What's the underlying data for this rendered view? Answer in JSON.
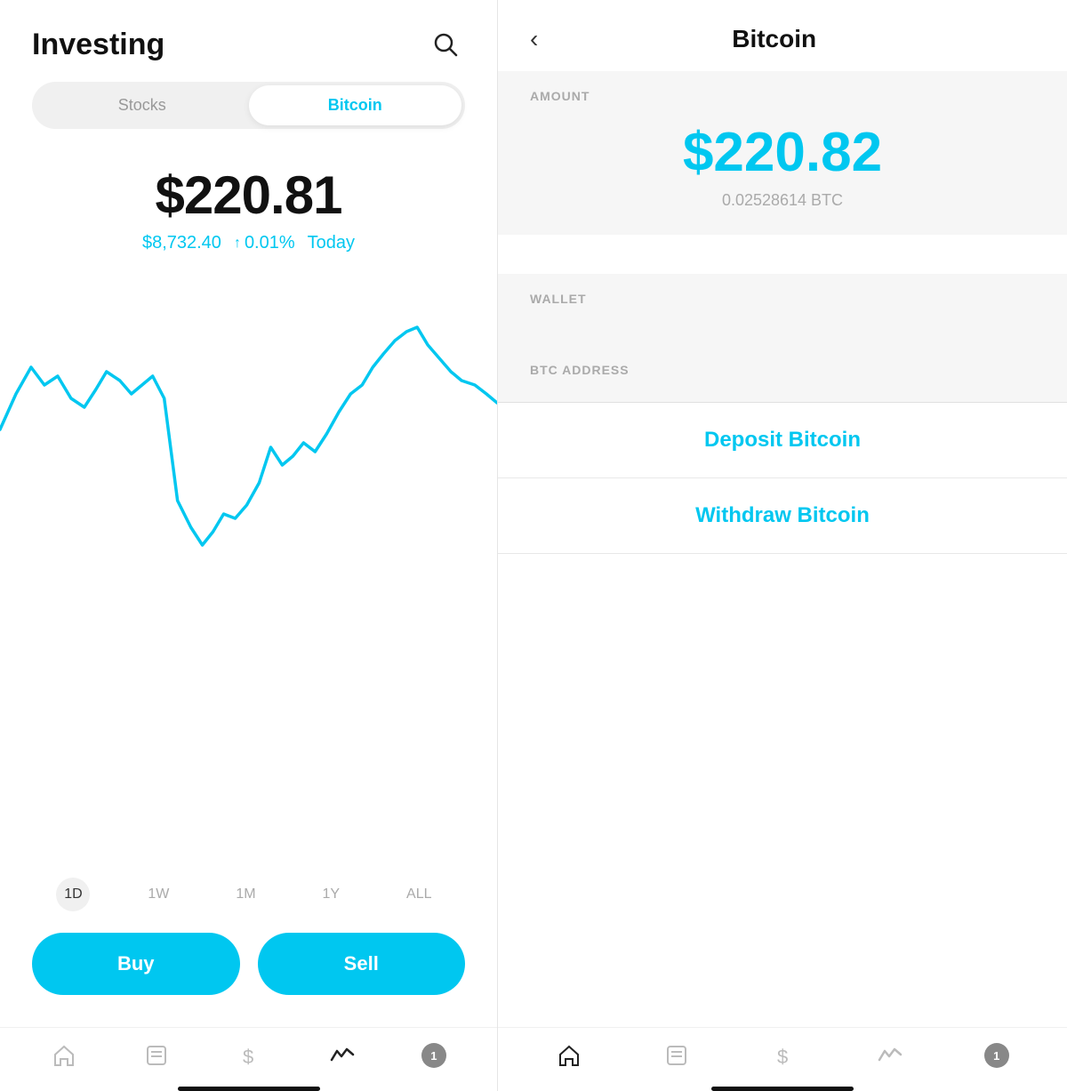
{
  "left": {
    "title": "Investing",
    "tabs": [
      {
        "label": "Stocks",
        "active": false
      },
      {
        "label": "Bitcoin",
        "active": true
      }
    ],
    "price": "$220.81",
    "btc_price": "$8,732.40",
    "change_arrow": "↑",
    "change_pct": "0.01%",
    "period": "Today",
    "time_ranges": [
      "1D",
      "1W",
      "1M",
      "1Y",
      "ALL"
    ],
    "active_range": "1D",
    "buy_label": "Buy",
    "sell_label": "Sell",
    "nav": {
      "items": [
        {
          "icon": "home-icon",
          "label": ""
        },
        {
          "icon": "news-icon",
          "label": ""
        },
        {
          "icon": "dollar-icon",
          "label": ""
        },
        {
          "icon": "activity-icon",
          "label": "",
          "active": true
        },
        {
          "icon": "notification-icon",
          "label": "1",
          "badge": true
        }
      ]
    }
  },
  "right": {
    "back_label": "‹",
    "title": "Bitcoin",
    "amount_label": "AMOUNT",
    "amount_value": "$220.82",
    "amount_btc": "0.02528614 BTC",
    "wallet_label": "WALLET",
    "btc_address_label": "BTC ADDRESS",
    "deposit_label": "Deposit Bitcoin",
    "withdraw_label": "Withdraw Bitcoin",
    "nav": {
      "items": [
        {
          "icon": "home-icon",
          "label": "",
          "active": true
        },
        {
          "icon": "news-icon",
          "label": ""
        },
        {
          "icon": "dollar-icon",
          "label": ""
        },
        {
          "icon": "activity-icon",
          "label": ""
        },
        {
          "icon": "notification-icon",
          "label": "1",
          "badge": true
        }
      ]
    }
  }
}
